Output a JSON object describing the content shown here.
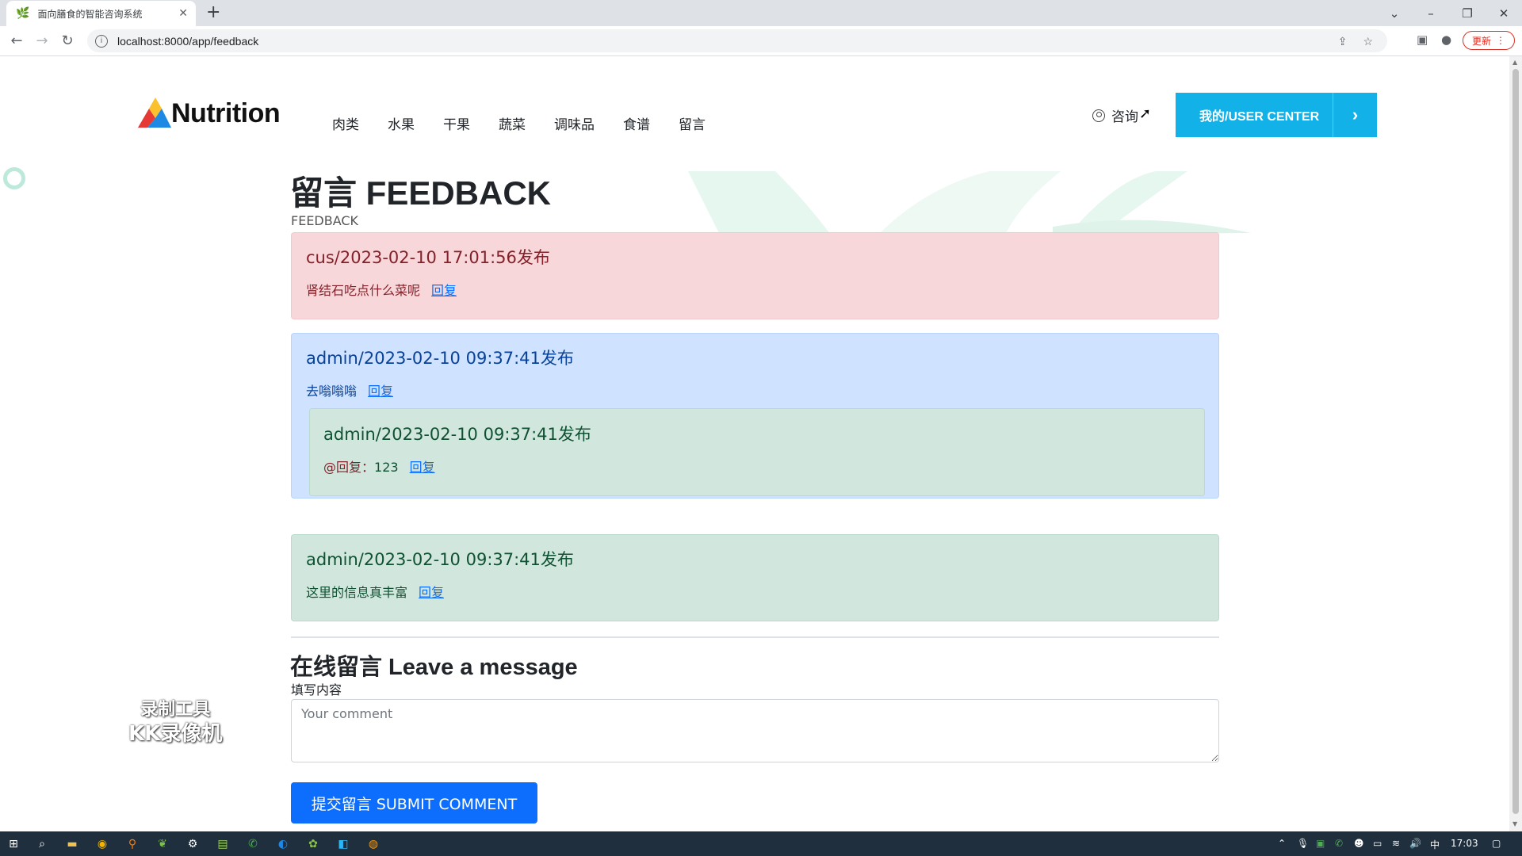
{
  "browser": {
    "tab_title": "面向膳食的智能咨询系统",
    "tab_favicon": "leaf-icon",
    "url": "localhost:8000/app/feedback",
    "update_label": "更新"
  },
  "site": {
    "logo_text": "Nutrition",
    "nav": [
      "肉类",
      "水果",
      "干果",
      "蔬菜",
      "调味品",
      "食谱",
      "留言"
    ],
    "consult_label": "咨询",
    "user_center_label": "我的/USER CENTER"
  },
  "page": {
    "title": "留言 FEEDBACK",
    "subtitle": "FEEDBACK"
  },
  "comments": [
    {
      "header": "cus/2023-02-10 17:01:56发布",
      "text": "肾结石吃点什么菜呢",
      "reply_label": "回复",
      "style": "danger"
    },
    {
      "header": "admin/2023-02-10 09:37:41发布",
      "text": "去嗡嗡嗡",
      "reply_label": "回复",
      "style": "primary",
      "replies": [
        {
          "header": "admin/2023-02-10 09:37:41发布",
          "at_label": "@回复：",
          "text": "123",
          "reply_label": "回复"
        }
      ]
    },
    {
      "header": "admin/2023-02-10 09:37:41发布",
      "text": "这里的信息真丰富",
      "reply_label": "回复",
      "style": "success"
    }
  ],
  "leave_message": {
    "title": "在线留言 Leave a message",
    "label": "填写内容",
    "placeholder": "Your comment",
    "submit_label": "提交留言 SUBMIT COMMENT"
  },
  "watermark": {
    "line1": "录制工具",
    "line2": "KK录像机"
  },
  "taskbar": {
    "time": "17:03",
    "ime": "中"
  },
  "colors": {
    "user_center_bg": "#12b1e8",
    "submit_bg": "#0d6efd",
    "danger_bg": "#f8d7da",
    "primary_bg": "#cfe2ff",
    "success_bg": "#d1e7dd"
  }
}
